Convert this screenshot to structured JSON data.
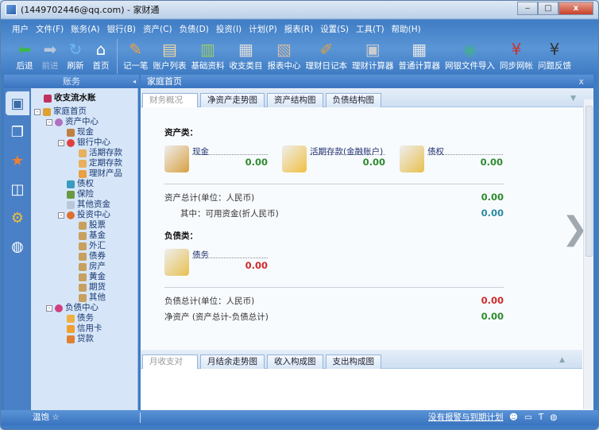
{
  "window": {
    "title": "(1449702446@qq.com) - 家财通",
    "min": "‒",
    "max": "□",
    "close": "x"
  },
  "menu": [
    "用户",
    "文件(F)",
    "账务(A)",
    "银行(B)",
    "资产(C)",
    "负债(D)",
    "投资(I)",
    "计划(P)",
    "报表(R)",
    "设置(S)",
    "工具(T)",
    "帮助(H)"
  ],
  "toolbar_nav": [
    {
      "label": "后退",
      "icon": "back-arrow-icon",
      "glyph": "⬅",
      "color": "#3cb84a"
    },
    {
      "label": "前进",
      "icon": "forward-arrow-icon",
      "glyph": "➡",
      "color": "#b8c8dc"
    },
    {
      "label": "刷新",
      "icon": "refresh-icon",
      "glyph": "↻",
      "color": "#6ab8f0"
    },
    {
      "label": "首页",
      "icon": "home-icon",
      "glyph": "⌂",
      "color": "#fff"
    }
  ],
  "toolbar_tools": [
    {
      "label": "记一笔",
      "icon": "pen-note-icon",
      "glyph": "✎",
      "color": "#f4a040"
    },
    {
      "label": "账户列表",
      "icon": "folder-icon",
      "glyph": "▤",
      "color": "#f0d8a0"
    },
    {
      "label": "基础资料",
      "icon": "books-icon",
      "glyph": "▥",
      "color": "#9c6"
    },
    {
      "label": "收支类目",
      "icon": "categories-icon",
      "glyph": "▦",
      "color": "#ddd"
    },
    {
      "label": "报表中心",
      "icon": "report-icon",
      "glyph": "▧",
      "color": "#cba"
    },
    {
      "label": "理财日记本",
      "icon": "diary-icon",
      "glyph": "✐",
      "color": "#e0a040"
    },
    {
      "label": "理财计算器",
      "icon": "calculator-icon",
      "glyph": "▣",
      "color": "#ccc"
    },
    {
      "label": "普通计算器",
      "icon": "basic-calculator-icon",
      "glyph": "▦",
      "color": "#e8e8e8"
    },
    {
      "label": "网银文件导入",
      "icon": "globe-import-icon",
      "glyph": "◉",
      "color": "#4a9"
    },
    {
      "label": "同步网帐",
      "icon": "sync-yen-icon",
      "glyph": "¥",
      "color": "#c33"
    },
    {
      "label": "问题反馈",
      "icon": "feedback-icon",
      "glyph": "¥",
      "color": "#333"
    }
  ],
  "left_panel": {
    "title": "账务",
    "collapse": "◂"
  },
  "right_panel": {
    "title": "家庭首页",
    "close": "x"
  },
  "tree": {
    "root_label": "收支流水账",
    "nodes": [
      {
        "label": "家庭首页",
        "level": 0,
        "pm": "-",
        "color": "#e0a030"
      },
      {
        "label": "资产中心",
        "level": 1,
        "pm": "-",
        "color": "#b070c0"
      },
      {
        "label": "现金",
        "level": 2,
        "color": "#c08040"
      },
      {
        "label": "银行中心",
        "level": 2,
        "pm": "-",
        "color": "#e04040"
      },
      {
        "label": "活期存款",
        "level": 3,
        "color": "#e8b060"
      },
      {
        "label": "定期存款",
        "level": 3,
        "color": "#e8b060"
      },
      {
        "label": "理财产品",
        "level": 3,
        "color": "#e8a040"
      },
      {
        "label": "债权",
        "level": 2,
        "color": "#3a9ac0"
      },
      {
        "label": "保险",
        "level": 2,
        "color": "#6a9a40"
      },
      {
        "label": "其他资金",
        "level": 2,
        "color": "#b8c8d8"
      },
      {
        "label": "投资中心",
        "level": 2,
        "pm": "-",
        "color": "#e07030"
      },
      {
        "label": "股票",
        "level": 3,
        "color": "#c8a060"
      },
      {
        "label": "基金",
        "level": 3,
        "color": "#c8a060"
      },
      {
        "label": "外汇",
        "level": 3,
        "color": "#c8a060"
      },
      {
        "label": "债券",
        "level": 3,
        "color": "#c8a060"
      },
      {
        "label": "房产",
        "level": 3,
        "color": "#c8a060"
      },
      {
        "label": "黄金",
        "level": 3,
        "color": "#c8a060"
      },
      {
        "label": "期货",
        "level": 3,
        "color": "#c8a060"
      },
      {
        "label": "其他",
        "level": 3,
        "color": "#c8a060"
      },
      {
        "label": "负债中心",
        "level": 1,
        "pm": "-",
        "color": "#d04080"
      },
      {
        "label": "债务",
        "level": 2,
        "color": "#f0b040"
      },
      {
        "label": "信用卡",
        "level": 2,
        "color": "#f0a030"
      },
      {
        "label": "贷款",
        "level": 2,
        "color": "#e08030"
      }
    ]
  },
  "tabs": [
    "财务概况",
    "净资产走势图",
    "资产结构图",
    "负债结构图"
  ],
  "overview": {
    "assets_title": "资产类：",
    "assets": [
      {
        "label": "现金",
        "value": "0.00",
        "color": "#d8a040"
      },
      {
        "label": "活期存款(金融账户)",
        "value": "0.00",
        "color": "#f0c040"
      },
      {
        "label": "债权",
        "value": "0.00",
        "color": "#e8c050"
      }
    ],
    "asset_total_label": "资产总计(单位：人民币)",
    "asset_total": "0.00",
    "available_label": "其中：可用资金(折人民币)",
    "available": "0.00",
    "liab_title": "负债类：",
    "liabilities": [
      {
        "label": "债务",
        "value": "0.00",
        "color": "#e8c050"
      }
    ],
    "liab_total_label": "负债总计(单位：人民币)",
    "liab_total": "0.00",
    "net_label": "净资产 (资产总计-负债总计)",
    "net": "0.00"
  },
  "bottom_tabs": [
    "月收支对比图",
    "月结余走势图",
    "收入构成图",
    "支出构成图"
  ],
  "status": {
    "level": "温饱 ☆",
    "link": "没有报警与到期计划"
  }
}
